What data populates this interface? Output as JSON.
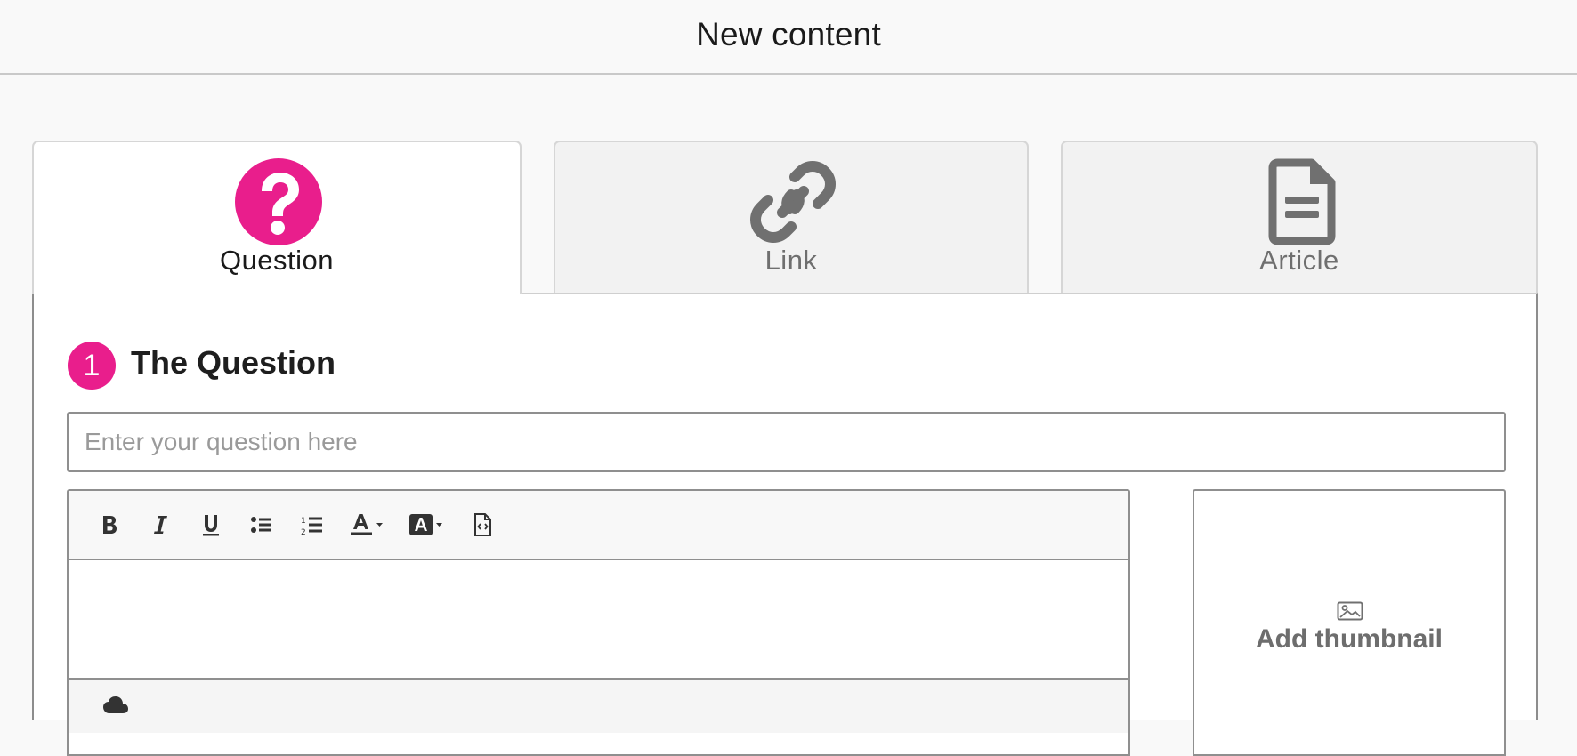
{
  "header": {
    "title": "New content"
  },
  "tabs": [
    {
      "label": "Question",
      "icon": "question-circle-icon",
      "active": true
    },
    {
      "label": "Link",
      "icon": "link-icon",
      "active": false
    },
    {
      "label": "Article",
      "icon": "document-icon",
      "active": false
    }
  ],
  "colors": {
    "accent": "#e91e8c",
    "inactive_icon": "#707070"
  },
  "question_section": {
    "step_number": "1",
    "title": "The Question",
    "input_placeholder": "Enter your question here",
    "input_value": ""
  },
  "editor": {
    "toolbar": [
      {
        "name": "bold-button",
        "icon": "bold-icon"
      },
      {
        "name": "italic-button",
        "icon": "italic-icon"
      },
      {
        "name": "underline-button",
        "icon": "underline-icon"
      },
      {
        "name": "bulleted-list-button",
        "icon": "bulleted-list-icon"
      },
      {
        "name": "numbered-list-button",
        "icon": "numbered-list-icon"
      },
      {
        "name": "text-color-button",
        "icon": "text-color-icon"
      },
      {
        "name": "highlight-color-button",
        "icon": "highlight-color-icon"
      },
      {
        "name": "source-code-button",
        "icon": "source-code-icon"
      }
    ]
  },
  "thumbnail": {
    "label": "Add thumbnail",
    "icon": "image-icon"
  }
}
